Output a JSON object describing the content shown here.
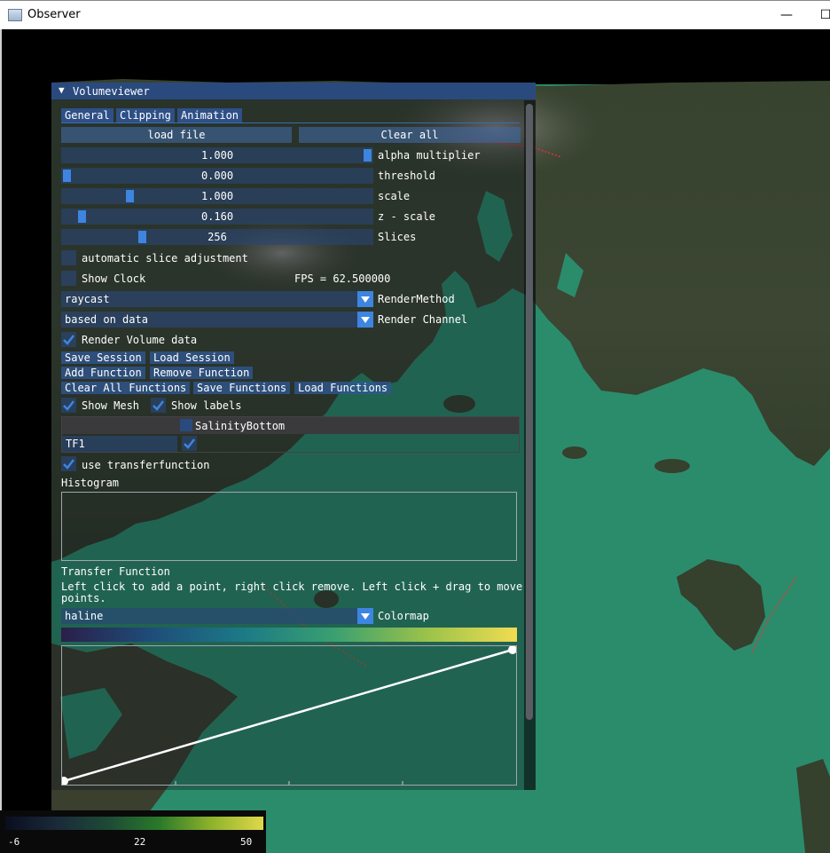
{
  "window": {
    "title": "Observer",
    "minimize_glyph": "—",
    "maximize_glyph": "☐",
    "icon": "app-window-icon"
  },
  "panel": {
    "title": "Volumeviewer",
    "collapse_glyph": "▼",
    "tabs": [
      "General",
      "Clipping",
      "Animation"
    ],
    "active_tab": "General",
    "buttons": {
      "load_file": "load file",
      "clear_all": "Clear all"
    },
    "sliders": [
      {
        "value": "1.000",
        "label": "alpha multiplier",
        "fraction": 1.0
      },
      {
        "value": "0.000",
        "label": "threshold",
        "fraction": 0.0
      },
      {
        "value": "1.000",
        "label": "scale",
        "fraction": 0.21
      },
      {
        "value": "0.160",
        "label": "z - scale",
        "fraction": 0.05
      },
      {
        "value": "256",
        "label": "Slices",
        "fraction": 0.25
      }
    ],
    "checkboxes": {
      "auto_slice": {
        "label": "automatic slice adjustment",
        "checked": false
      },
      "show_clock": {
        "label": "Show Clock",
        "checked": false
      },
      "render_volume": {
        "label": "Render Volume data",
        "checked": true
      },
      "show_mesh": {
        "label": "Show Mesh",
        "checked": true
      },
      "show_labels": {
        "label": "Show labels",
        "checked": true
      },
      "use_tf": {
        "label": "use transferfunction",
        "checked": true
      }
    },
    "fps": "FPS = 62.500000",
    "render_method": {
      "value": "raycast",
      "label": "RenderMethod"
    },
    "render_channel": {
      "value": "based on data",
      "label": "Render Channel"
    },
    "session_buttons": {
      "save_session": "Save Session",
      "load_session": "Load Session",
      "add_function": "Add Function",
      "remove_function": "Remove Function",
      "clear_all_functions": "Clear All Functions",
      "save_functions": "Save Functions",
      "load_functions": "Load Functions"
    },
    "channel_table": {
      "header": "SalinityBottom",
      "row_name": "TF1",
      "row_checked": true
    },
    "histogram_label": "Histogram",
    "transfer_function": {
      "label": "Transfer Function",
      "help": "Left click to add a point, right click remove. Left click + drag to move",
      "help_cont": "points.",
      "colormap_value": "haline",
      "colormap_label": "Colormap"
    }
  },
  "legend": {
    "ticks": [
      "-6",
      "22",
      "50"
    ],
    "gradient": [
      "#0a0e1e",
      "#1a2a3a",
      "#1d4a36",
      "#2b7a2a",
      "#8fb32a",
      "#e0d84a"
    ]
  },
  "colors": {
    "accent": "#3d85e0",
    "header": "#2a4a7e",
    "water": "#2b8c6c",
    "colormap_haline": [
      "#2a1f4a",
      "#1e4d7a",
      "#1c7a86",
      "#3aa070",
      "#9ac24a",
      "#f0dc52"
    ]
  }
}
